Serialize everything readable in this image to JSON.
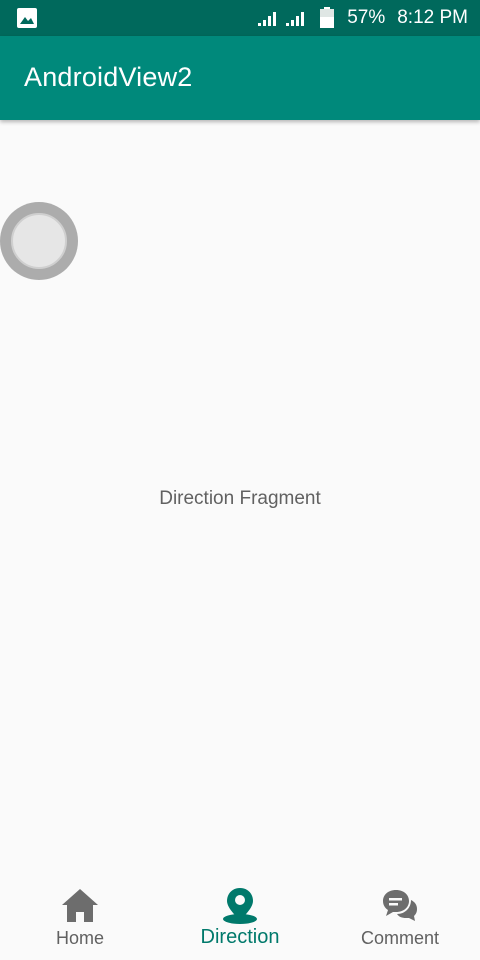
{
  "status_bar": {
    "battery": "57%",
    "time": "8:12 PM",
    "icons": [
      "gallery-icon",
      "signal-icon",
      "signal-icon",
      "battery-icon"
    ]
  },
  "app_bar": {
    "title": "AndroidView2"
  },
  "content": {
    "fragment_text": "Direction Fragment"
  },
  "bottom_nav": {
    "items": [
      {
        "label": "Home",
        "icon": "home-icon",
        "active": false
      },
      {
        "label": "Direction",
        "icon": "location-pin-icon",
        "active": true
      },
      {
        "label": "Comment",
        "icon": "comment-icon",
        "active": false
      }
    ]
  },
  "colors": {
    "status_bar": "#00695c",
    "app_bar": "#00897b",
    "active": "#00796b",
    "inactive": "#616161",
    "background": "#fafafa"
  }
}
